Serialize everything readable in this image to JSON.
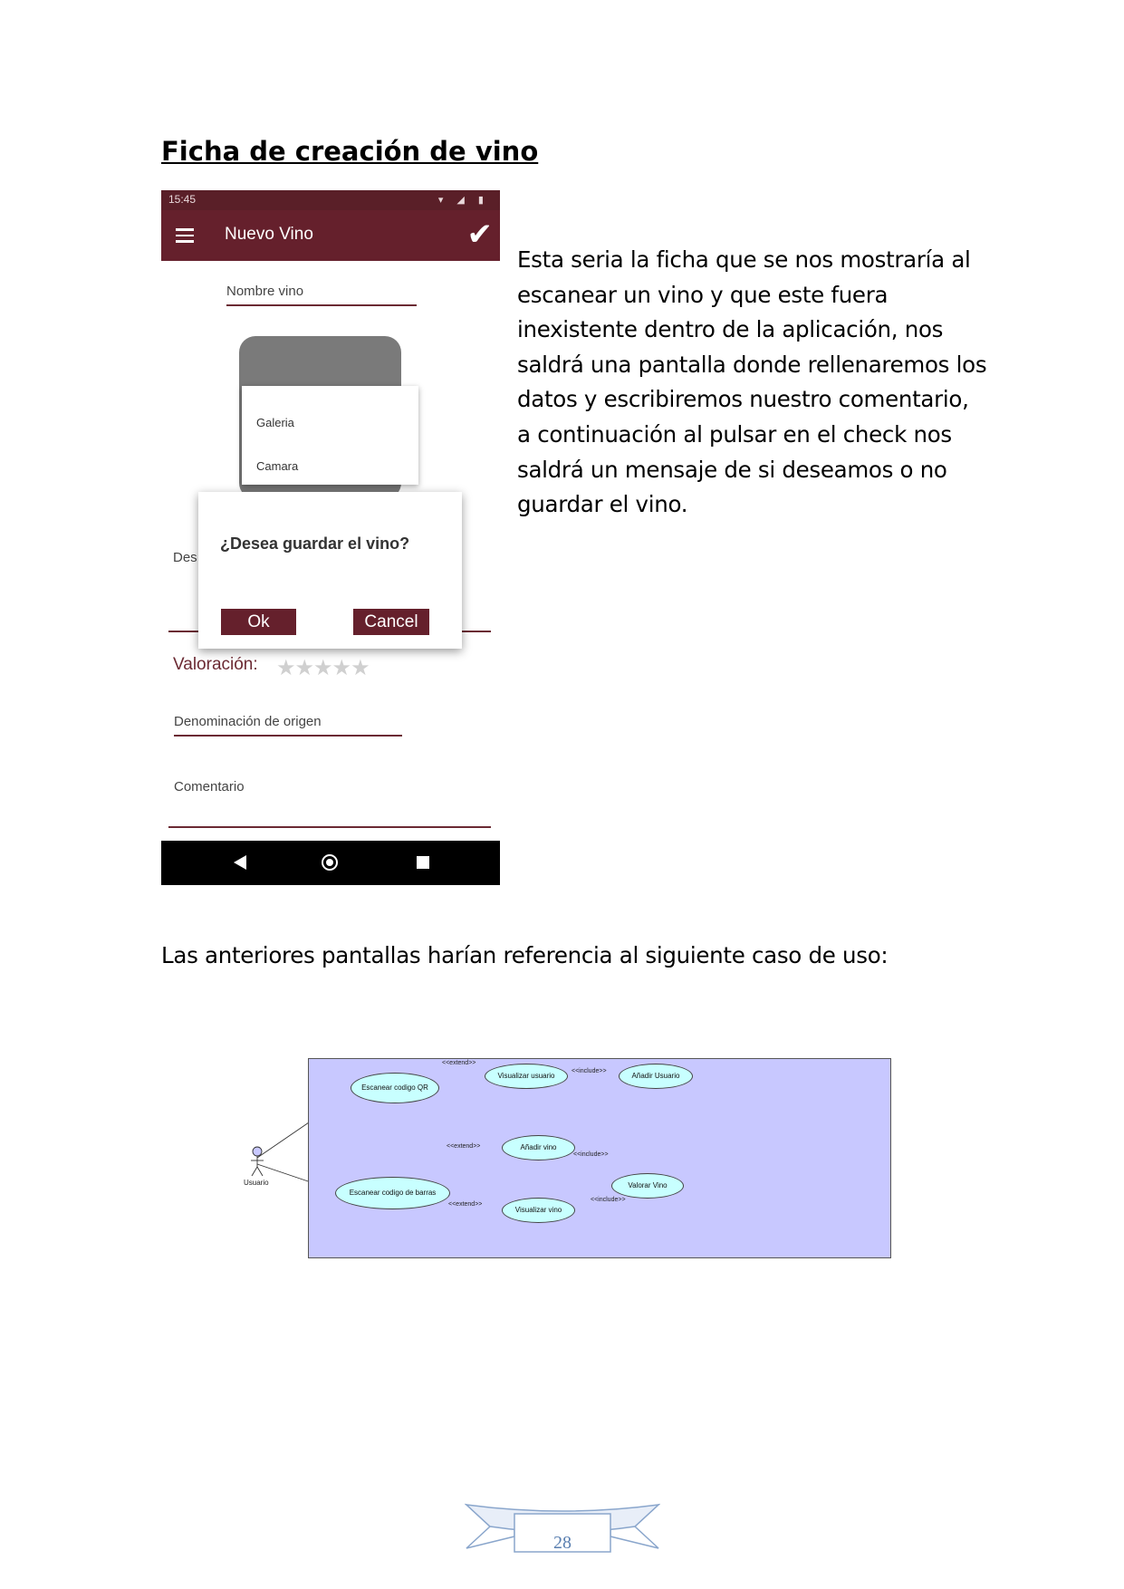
{
  "heading": "Ficha de creación de vino",
  "paragraph": "Esta seria la ficha que se nos mostraría al escanear un vino y que este fuera inexistente dentro de la aplicación, nos saldrá una pantalla donde rellenaremos los datos y escribiremos nuestro comentario, a continuación al pulsar en el check nos saldrá un mensaje de si deseamos o no guardar el vino.",
  "paragraph2": "Las anteriores pantallas harían referencia al siguiente caso de uso:",
  "phone": {
    "status_time": "15:45",
    "status_icons": "▾ ◢ ▮",
    "title": "Nuevo Vino",
    "nombre_label": "Nombre vino",
    "menu_items": [
      "Galeria",
      "Camara"
    ],
    "descripcion_label_partial": "Des",
    "dialog_title": "¿Desea guardar el vino?",
    "ok_label": "Ok",
    "cancel_label": "Cancel",
    "valoracion_label": "Valoración:",
    "rating": {
      "value": 0,
      "max": 5
    },
    "stars": "★★★★★",
    "denominacion_label": "Denominación de origen",
    "comentario_label": "Comentario",
    "colors": {
      "appbar": "#65202c",
      "statusbar": "#5a1f28",
      "accent": "#6b2a33"
    }
  },
  "diagram": {
    "actor": "Usuario",
    "use_cases": {
      "escanear_qr": "Escanear codigo QR",
      "visualizar_usuario": "Visualizar usuario",
      "anadir_usuario": "Añadir Usuario",
      "anadir_vino": "Añadir vino",
      "valorar_vino": "Valorar Vino",
      "escanear_barras": "Escanear codigo de barras",
      "visualizar_vino": "Visualizar vino"
    },
    "stereotypes": {
      "extend_top": "<<extend>>",
      "include_top": "<<include>>",
      "extend_mid": "<<extend>>",
      "include_mid": "<<include>>",
      "include_bottom": "<<include>>",
      "extend_bottom": "<<extend>>"
    },
    "colors": {
      "background": "#c8c8ff",
      "use_case_fill": "#c8ffff"
    }
  },
  "page_number": "28"
}
